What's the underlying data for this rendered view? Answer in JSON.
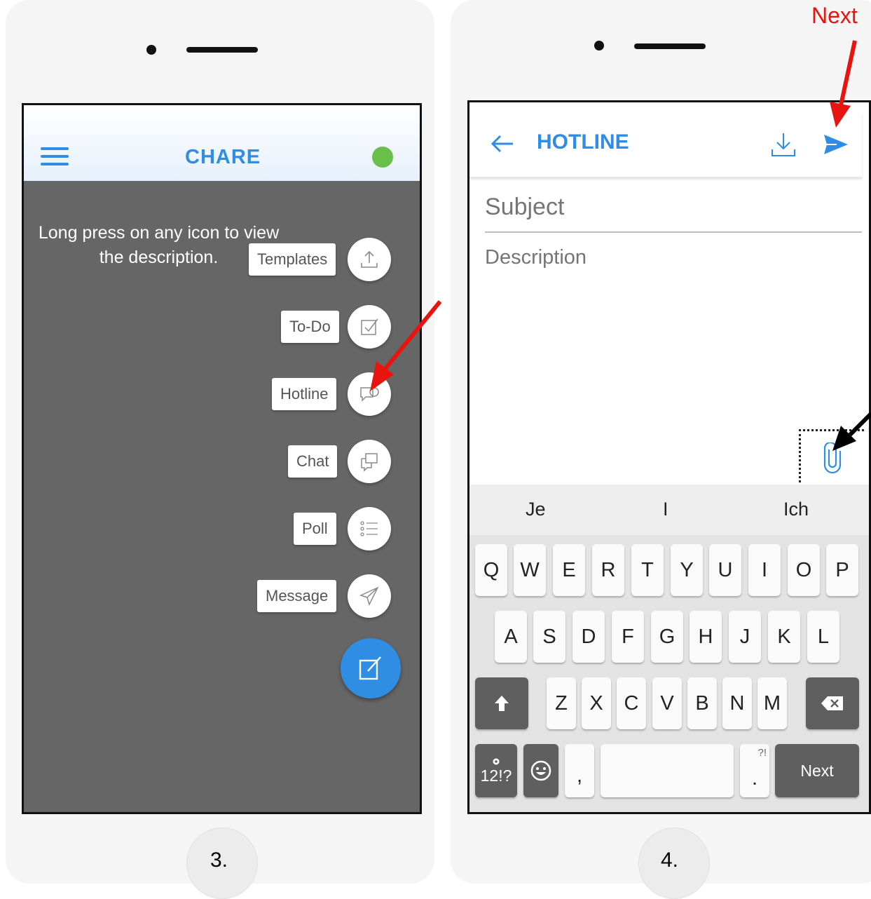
{
  "left_phone": {
    "step_number": "3.",
    "app_title": "CHARE",
    "hint": "Long press on any icon to view the description.",
    "fab_items": [
      {
        "label": "Templates",
        "icon": "upload-icon"
      },
      {
        "label": "To-Do",
        "icon": "checkbox-icon"
      },
      {
        "label": "Hotline",
        "icon": "chat-bubble-icon"
      },
      {
        "label": "Chat",
        "icon": "copy-chat-icon"
      },
      {
        "label": "Poll",
        "icon": "list-icon"
      },
      {
        "label": "Message",
        "icon": "paper-plane-icon"
      }
    ],
    "fab_main_icon": "compose-icon"
  },
  "right_phone": {
    "step_number": "4.",
    "title": "HOTLINE",
    "subject_placeholder": "Subject",
    "description_placeholder": "Description",
    "suggestions": [
      "Je",
      "I",
      "Ich"
    ],
    "keyboard_rows": [
      [
        "Q",
        "W",
        "E",
        "R",
        "T",
        "Y",
        "U",
        "I",
        "O",
        "P"
      ],
      [
        "A",
        "S",
        "D",
        "F",
        "G",
        "H",
        "J",
        "K",
        "L"
      ],
      [
        "Z",
        "X",
        "C",
        "V",
        "B",
        "N",
        "M"
      ]
    ],
    "symbols_key": "12!?",
    "comma_key": ",",
    "period_key": ".",
    "period_alt": "?!",
    "action_key": "Next"
  },
  "annotation": {
    "next_label": "Next"
  },
  "colors": {
    "accent": "#2f8ee3",
    "status_online": "#6abf4b",
    "overlay": "#666666",
    "annotation_red": "#e8140f"
  }
}
